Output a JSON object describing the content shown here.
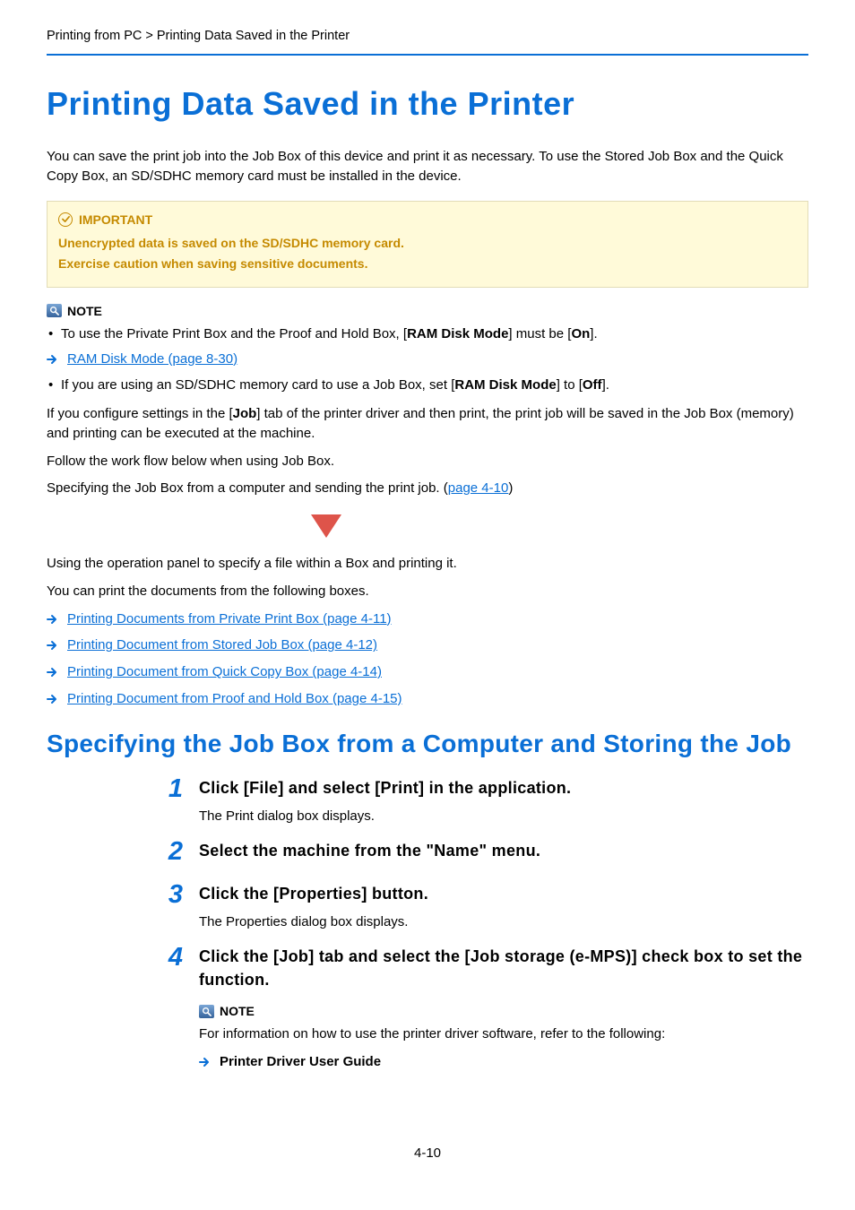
{
  "breadcrumb": "Printing from PC > Printing Data Saved in the Printer",
  "h1": "Printing Data Saved in the Printer",
  "intro": "You can save the print job into the Job Box of this device and print it as necessary. To use the Stored Job Box and the Quick Copy Box, an SD/SDHC memory card must be installed in the device.",
  "important": {
    "label": "IMPORTANT",
    "line1": "Unencrypted data is saved on the SD/SDHC memory card.",
    "line2": "Exercise caution when saving sensitive documents."
  },
  "note1": {
    "label": "NOTE",
    "bullet1_pre": "To use the Private Print Box and the Proof and Hold Box, [",
    "bullet1_b1": "RAM Disk Mode",
    "bullet1_mid": "] must be [",
    "bullet1_b2": "On",
    "bullet1_post": "].",
    "link": "RAM Disk Mode (page 8-30)",
    "bullet2_pre": "If you are using an SD/SDHC memory card to use a Job Box, set [",
    "bullet2_b1": "RAM Disk Mode",
    "bullet2_mid": "] to [",
    "bullet2_b2": "Off",
    "bullet2_post": "]."
  },
  "para1_pre": "If you configure settings in the [",
  "para1_b": "Job",
  "para1_post": "] tab of the printer driver and then print, the print job will be saved in the Job Box (memory) and printing can be executed at the machine.",
  "para2": "Follow the work flow below when using Job Box.",
  "para3_pre": "Specifying the Job Box from a computer and sending the print job. (",
  "para3_link": "page 4-10",
  "para3_post": ")",
  "para4": "Using the operation panel to specify a file within a Box and printing it.",
  "para5": "You can print the documents from the following boxes.",
  "links": {
    "l1": "Printing Documents from Private Print Box (page 4-11)",
    "l2": "Printing Document from Stored Job Box (page 4-12)",
    "l3": "Printing Document from Quick Copy Box (page 4-14)",
    "l4": "Printing Document from Proof and Hold Box (page 4-15)"
  },
  "h2": "Specifying the Job Box from a Computer and Storing the Job",
  "steps": {
    "s1": {
      "num": "1",
      "title": "Click [File] and select [Print] in the application.",
      "text": "The Print dialog box displays."
    },
    "s2": {
      "num": "2",
      "title": "Select the machine from the \"Name\" menu."
    },
    "s3": {
      "num": "3",
      "title": "Click the [Properties] button.",
      "text": "The Properties dialog box displays."
    },
    "s4": {
      "num": "4",
      "title": "Click the [Job] tab and select the [Job storage (e-MPS)] check box to set the function.",
      "note_label": "NOTE",
      "note_text": "For information on how to use the printer driver software, refer to the following:",
      "ref": "Printer Driver User Guide"
    }
  },
  "page_num": "4-10"
}
